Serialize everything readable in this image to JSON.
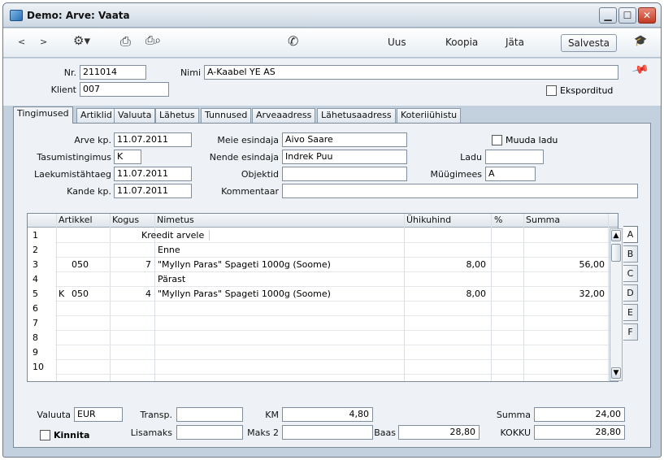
{
  "window": {
    "title": "Demo: Arve: Vaata"
  },
  "toolbar": {
    "back": "<",
    "forward": ">",
    "gear": "⚙▾",
    "print": "⎙",
    "preview": "⎙⌕",
    "phone": "✆",
    "new": "Uus",
    "copy": "Koopia",
    "skip": "Jäta",
    "save": "Salvesta",
    "cap": "🎓"
  },
  "header": {
    "nr_label": "Nr.",
    "nr_value": "211014",
    "name_label": "Nimi",
    "name_value": "A-Kaabel YE AS",
    "client_label": "Klient",
    "client_value": "007",
    "exported_label": "Eksporditud"
  },
  "tabs": [
    "Tingimused",
    "Artiklid",
    "Valuuta",
    "Lähetus",
    "Tunnused",
    "Arveaadress",
    "Lähetusaadress",
    "Koteriiühistu"
  ],
  "terms": {
    "invoice_date_label": "Arve kp.",
    "invoice_date": "11.07.2011",
    "payment_terms_label": "Tasumistingimus",
    "payment_terms": "K",
    "due_date_label": "Laekumistähtaeg",
    "due_date": "11.07.2011",
    "trans_date_label": "Kande kp.",
    "trans_date": "11.07.2011",
    "our_rep_label": "Meie esindaja",
    "our_rep": "Aivo Saare",
    "their_rep_label": "Nende esindaja",
    "their_rep": "Indrek Puu",
    "objects_label": "Objektid",
    "objects": "",
    "comment_label": "Kommentaar",
    "comment": "",
    "change_stock_label": "Muuda ladu",
    "stock_label": "Ladu",
    "stock": "",
    "salesman_label": "Müügimees",
    "salesman": "A"
  },
  "grid": {
    "headers": [
      "Artikkel",
      "Kogus",
      "Nimetus",
      "Ühikuhind",
      "%",
      "Summa"
    ],
    "rows": [
      {
        "n": "1",
        "k": "",
        "item": "",
        "qty": "",
        "desc": "Kreedit arvele",
        "price": "",
        "pct": "",
        "sum": ""
      },
      {
        "n": "2",
        "k": "",
        "item": "",
        "qty": "",
        "desc": "Enne",
        "price": "",
        "pct": "",
        "sum": ""
      },
      {
        "n": "3",
        "k": "",
        "item": "050",
        "qty": "7",
        "desc": "\"Myllyn Paras\" Spageti 1000g  (Soome)",
        "price": "8,00",
        "pct": "",
        "sum": "56,00"
      },
      {
        "n": "4",
        "k": "",
        "item": "",
        "qty": "",
        "desc": "Pärast",
        "price": "",
        "pct": "",
        "sum": ""
      },
      {
        "n": "5",
        "k": "K",
        "item": "050",
        "qty": "4",
        "desc": "\"Myllyn Paras\" Spageti 1000g  (Soome)",
        "price": "8,00",
        "pct": "",
        "sum": "32,00"
      },
      {
        "n": "6",
        "k": "",
        "item": "",
        "qty": "",
        "desc": "",
        "price": "",
        "pct": "",
        "sum": ""
      },
      {
        "n": "7",
        "k": "",
        "item": "",
        "qty": "",
        "desc": "",
        "price": "",
        "pct": "",
        "sum": ""
      },
      {
        "n": "8",
        "k": "",
        "item": "",
        "qty": "",
        "desc": "",
        "price": "",
        "pct": "",
        "sum": ""
      },
      {
        "n": "9",
        "k": "",
        "item": "",
        "qty": "",
        "desc": "",
        "price": "",
        "pct": "",
        "sum": ""
      },
      {
        "n": "10",
        "k": "",
        "item": "",
        "qty": "",
        "desc": "",
        "price": "",
        "pct": "",
        "sum": ""
      }
    ],
    "side_tabs": [
      "A",
      "B",
      "C",
      "D",
      "E",
      "F"
    ]
  },
  "footer": {
    "currency_label": "Valuuta",
    "currency": "EUR",
    "transp_label": "Transp.",
    "transp": "",
    "vat_label": "KM",
    "vat": "4,80",
    "sum_label": "Summa",
    "sum": "24,00",
    "extra_label": "Lisamaks",
    "extra": "",
    "tax2_label": "Maks 2",
    "tax2": "",
    "base_label": "Baas",
    "base": "28,80",
    "total_label": "KOKKU",
    "total": "28,80",
    "approve_label": "Kinnita"
  }
}
